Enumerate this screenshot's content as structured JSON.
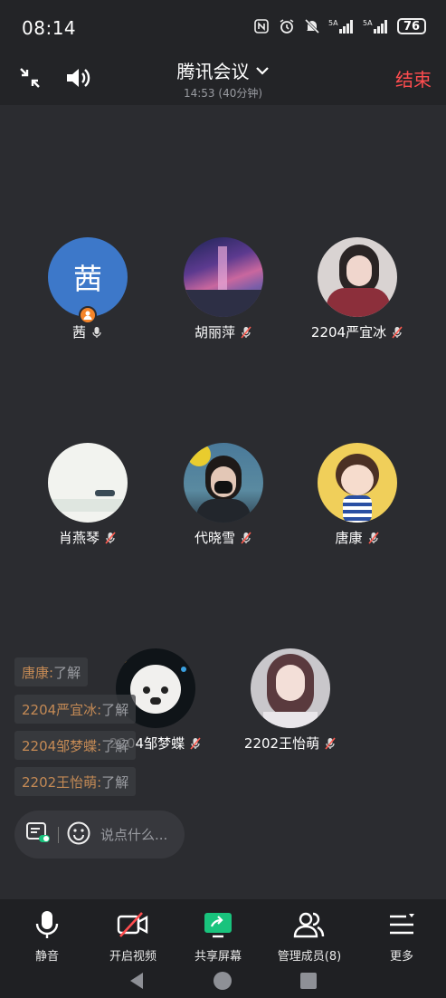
{
  "status_bar": {
    "time": "08:14",
    "icons": [
      "nfc-icon",
      "alarm-icon",
      "mute-icon",
      "signal-5g-icon",
      "signal-5g-icon"
    ],
    "battery": "76"
  },
  "header": {
    "title": "腾讯会议",
    "subtitle": "14:53 (40分钟)",
    "end_label": "结束",
    "end_color": "#ff4d4f"
  },
  "participants": [
    {
      "name": "茜",
      "avatar_text": "茜",
      "mic": "on",
      "host": true,
      "avatar_color": "#3d78c9"
    },
    {
      "name": "胡丽萍",
      "mic": "muted"
    },
    {
      "name": "2204严宜冰",
      "mic": "muted"
    },
    {
      "name": "肖燕琴",
      "mic": "muted"
    },
    {
      "name": "代晓雪",
      "mic": "muted"
    },
    {
      "name": "唐康",
      "mic": "muted"
    },
    {
      "name": "2204邹梦蝶",
      "mic": "muted"
    },
    {
      "name": "2202王怡萌",
      "mic": "muted"
    }
  ],
  "chat": {
    "messages": [
      {
        "sender": "唐康:",
        "text": " 了解"
      },
      {
        "sender": "2204严宜冰:",
        "text": " 了解"
      },
      {
        "sender": "2204邹梦蝶:",
        "text": " 了解"
      },
      {
        "sender": "2202王怡萌:",
        "text": " 了解"
      }
    ],
    "input_placeholder": "说点什么..."
  },
  "toolbar": {
    "items": [
      {
        "label": "静音",
        "icon": "microphone-icon"
      },
      {
        "label": "开启视频",
        "icon": "video-off-icon"
      },
      {
        "label": "共享屏幕",
        "icon": "share-screen-icon"
      },
      {
        "label": "管理成员(8)",
        "icon": "members-icon"
      },
      {
        "label": "更多",
        "icon": "more-menu-icon"
      }
    ],
    "accent": "#19c37d"
  }
}
